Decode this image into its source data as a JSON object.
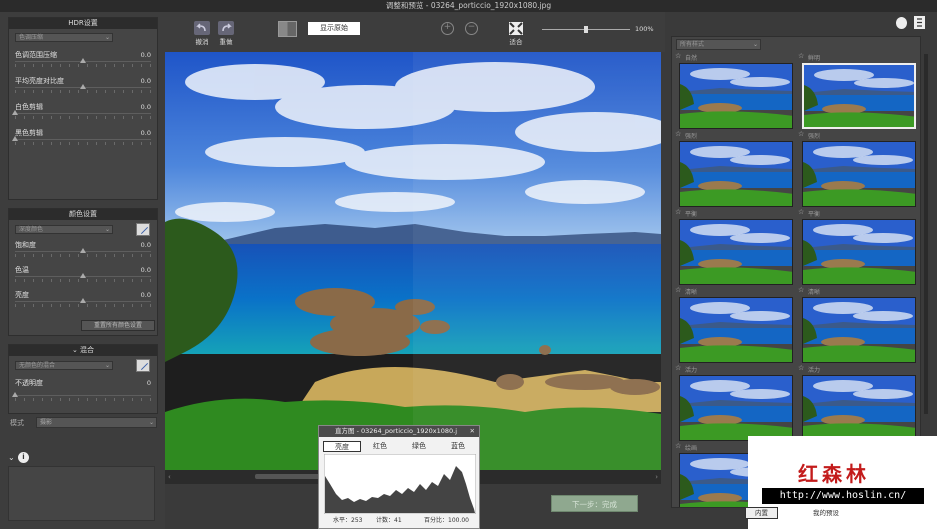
{
  "window": {
    "title": "调整和预览 - 03264_porticcio_1920x1080.jpg"
  },
  "hdr_panel": {
    "title": "HDR设置",
    "preset": "色调压缩",
    "sliders": [
      {
        "label": "色调范围压缩",
        "value": "0.0",
        "pos": 0.5
      },
      {
        "label": "平均亮度对比度",
        "value": "0.0",
        "pos": 0.5
      },
      {
        "label": "白色剪辑",
        "value": "0.0",
        "pos": 0.0
      },
      {
        "label": "黑色剪辑",
        "value": "0.0",
        "pos": 0.0
      }
    ]
  },
  "color_panel": {
    "title": "颜色设置",
    "preset": "深度颜色",
    "sliders": [
      {
        "label": "饱和度",
        "value": "0.0",
        "pos": 0.5
      },
      {
        "label": "色温",
        "value": "0.0",
        "pos": 0.5
      },
      {
        "label": "亮度",
        "value": "0.0",
        "pos": 0.5
      }
    ],
    "reset_label": "重置所有颜色设置"
  },
  "blend_panel": {
    "title": "混合",
    "mode": "无颜色的混合",
    "opacity_label": "不透明度",
    "opacity_value": "0",
    "pos": 0.0
  },
  "engine": {
    "label": "模式",
    "value": "摄影"
  },
  "toolbar": {
    "undo": "撤消",
    "redo": "重做",
    "show_original": "显示原始",
    "fit": "适合",
    "zoom": "100%"
  },
  "styles": {
    "filter": "所有样式",
    "thumbs": [
      {
        "name": "自然"
      },
      {
        "name": "鲜明",
        "selected": true
      },
      {
        "name": "强烈"
      },
      {
        "name": "强烈"
      },
      {
        "name": "平衡"
      },
      {
        "name": "平衡"
      },
      {
        "name": "清晰"
      },
      {
        "name": "清晰"
      },
      {
        "name": "活力"
      },
      {
        "name": "活力"
      },
      {
        "name": "绘画"
      },
      {
        "name": "绘画"
      }
    ],
    "tabs": [
      "内置",
      "我的预设"
    ]
  },
  "histogram": {
    "title": "直方图 - 03264_porticcio_1920x1080.j",
    "tabs": [
      "亮度",
      "红色",
      "绿色",
      "蓝色"
    ],
    "level": "水平：253",
    "count": "计数：41",
    "percentile": "百分比：100.00"
  },
  "next_button": "下一步：完成",
  "watermark": {
    "brand": "红森林",
    "url": "http://www.hoslin.cn/"
  },
  "colors": {
    "bg": "#3a3a3a",
    "panel": "#454545",
    "header": "#2c2c2c",
    "accent_green": "#8fa88f"
  }
}
